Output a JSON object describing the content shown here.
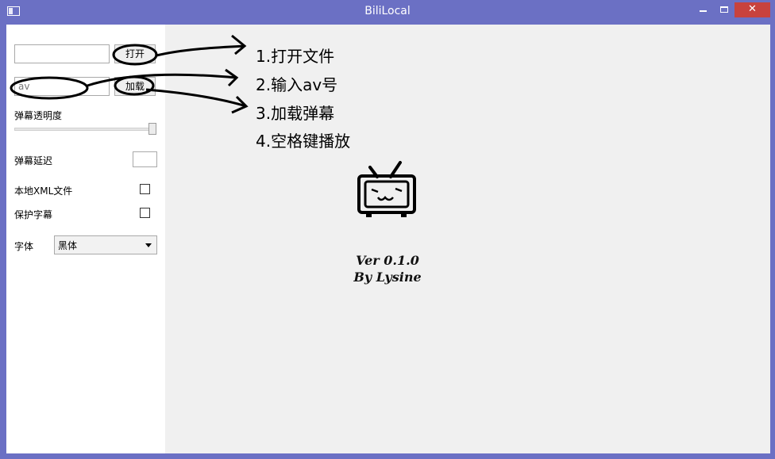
{
  "window": {
    "title": "BiliLocal"
  },
  "sidebar": {
    "file_input": {
      "value": "",
      "placeholder": ""
    },
    "open_button": "打开",
    "av_input": {
      "value": "av",
      "placeholder": "av"
    },
    "load_button": "加载",
    "opacity_label": "弹幕透明度",
    "opacity_value": 1.0,
    "delay_label": "弹幕延迟",
    "delay_value": "",
    "local_xml_label": "本地XML文件",
    "local_xml_checked": false,
    "protect_sub_label": "保护字幕",
    "protect_sub_checked": false,
    "font_label": "字体",
    "font_value": "黑体"
  },
  "main": {
    "steps": [
      "1.打开文件",
      "2.输入av号",
      "3.加载弹幕",
      "4.空格键播放"
    ],
    "version": "Ver 0.1.0",
    "author": "By Lysine"
  },
  "colors": {
    "frame": "#6b70c4",
    "close": "#c8423d",
    "panel": "#f0f0f0"
  },
  "icons": [
    "app-icon",
    "minimize-icon",
    "maximize-icon",
    "close-icon",
    "tv-logo-icon",
    "dropdown-arrow-icon"
  ]
}
